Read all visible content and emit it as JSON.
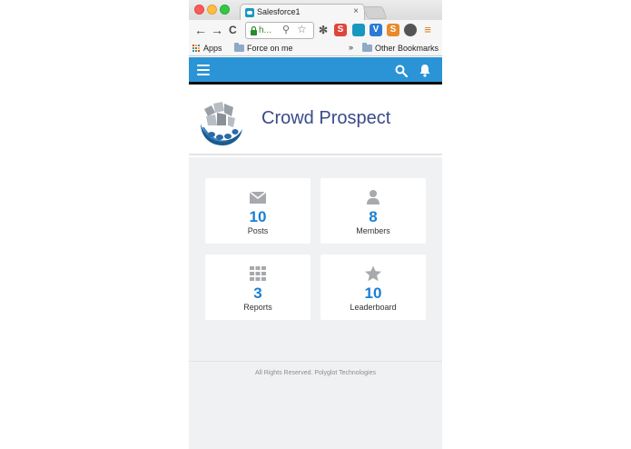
{
  "browser": {
    "tab_title": "Salesforce1",
    "tab_close": "×",
    "omnibox_text": "h...",
    "back": "←",
    "forward": "→",
    "reload": "C",
    "extensions": [
      "S",
      "V",
      "S"
    ],
    "bookmarks": {
      "apps": "Apps",
      "folder1": "Force on me",
      "overflow": "»",
      "other": "Other Bookmarks"
    }
  },
  "app": {
    "brand_name": "Crowd Prospect",
    "accent_color": "#2a94d6",
    "cards": [
      {
        "icon": "envelope-icon",
        "count": "10",
        "label": "Posts"
      },
      {
        "icon": "user-icon",
        "count": "8",
        "label": "Members"
      },
      {
        "icon": "grid-icon",
        "count": "3",
        "label": "Reports"
      },
      {
        "icon": "star-icon",
        "count": "10",
        "label": "Leaderboard"
      }
    ],
    "footer": "All Rights Reserved. Polyglot Technologies"
  }
}
